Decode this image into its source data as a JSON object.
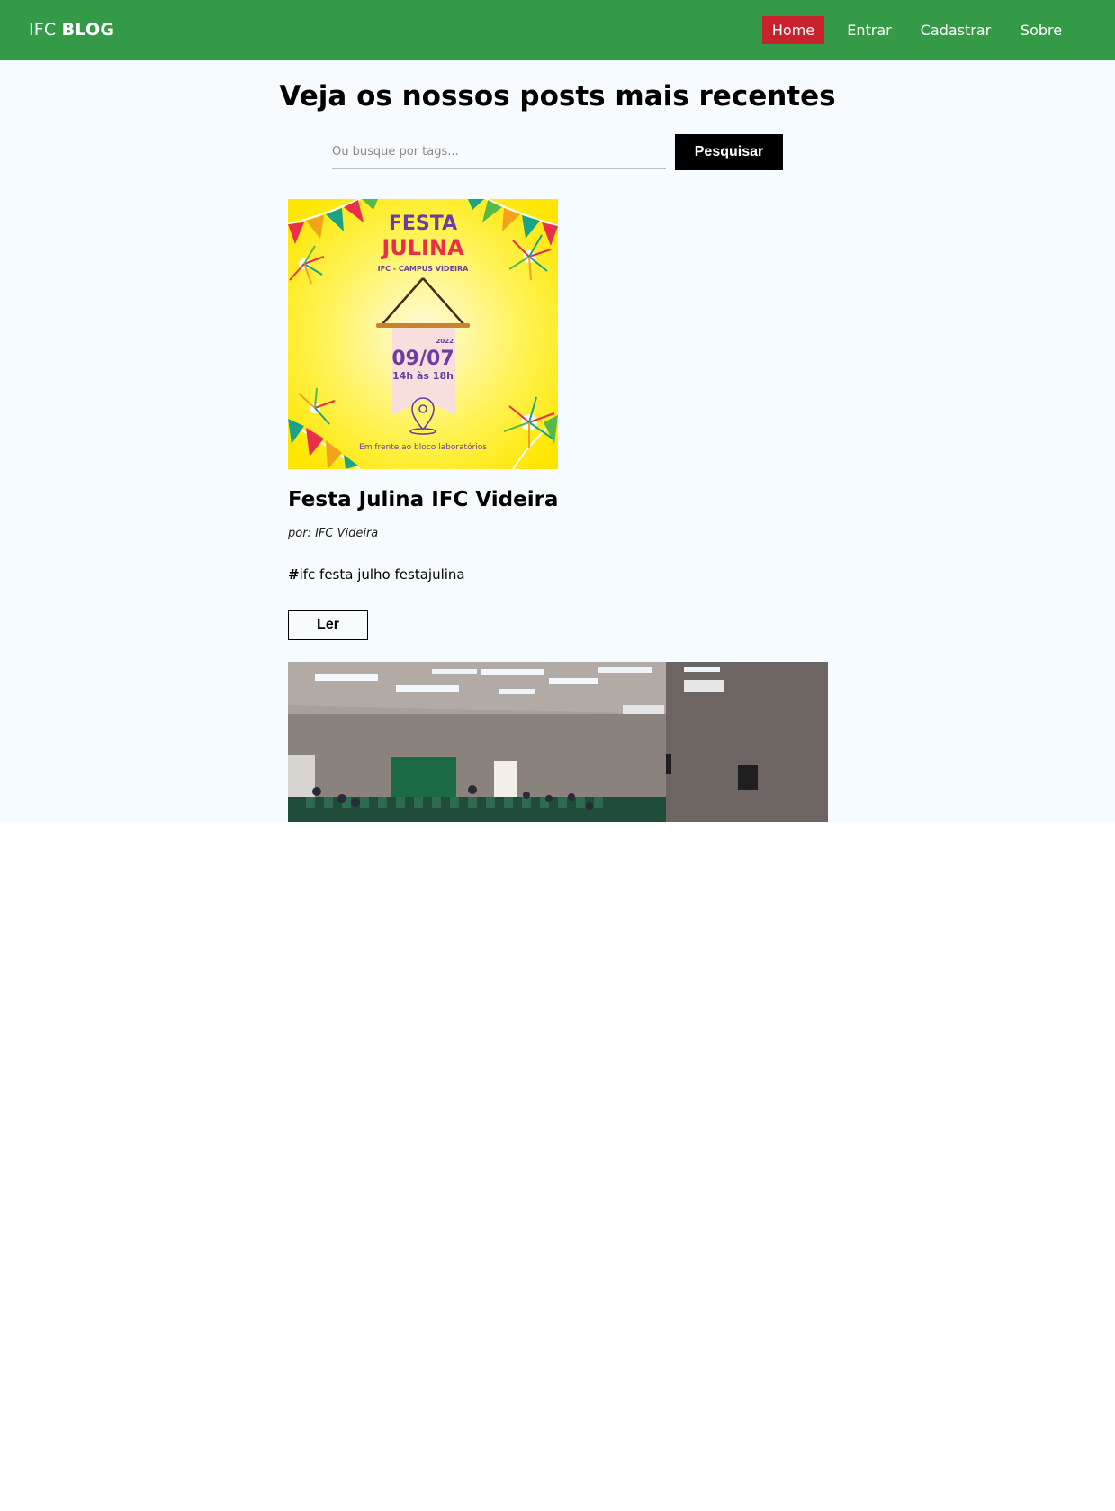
{
  "nav": {
    "brand_light": "IFC",
    "brand_bold": "BLOG",
    "items": [
      {
        "label": "Home",
        "active": true
      },
      {
        "label": "Entrar"
      },
      {
        "label": "Cadastrar"
      },
      {
        "label": "Sobre"
      }
    ],
    "colors": {
      "bar": "#359a47",
      "active": "#c8222c"
    }
  },
  "main": {
    "title": "Veja os nossos posts mais recentes",
    "search": {
      "placeholder": "Ou busque por tags...",
      "value": "",
      "button_label": "Pesquisar"
    }
  },
  "posts": [
    {
      "image": {
        "heading_line1": "FESTA",
        "heading_line2": "JULINA",
        "subheading": "IFC - CAMPUS VIDEIRA",
        "year": "2022",
        "date": "09/07",
        "time": "14h às 18h",
        "location": "Em frente ao bloco laboratórios"
      },
      "title": "Festa Julina IFC Videira",
      "author": "por: IFC Videira",
      "tags_hash": "#",
      "tags": "ifc festa julho festajulina",
      "read_label": "Ler"
    },
    {
      "image": {
        "description_icon": "auditorium-photo"
      }
    }
  ]
}
